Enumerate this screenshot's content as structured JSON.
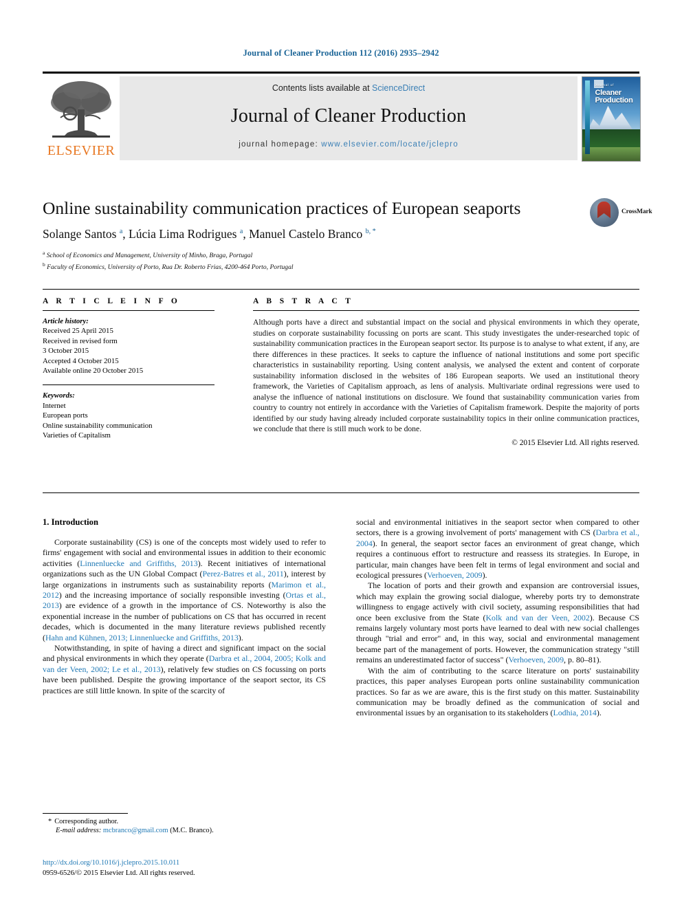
{
  "running_head": "Journal of Cleaner Production 112 (2016) 2935–2942",
  "banner": {
    "contents_prefix": "Contents lists available at ",
    "sciencedirect": "ScienceDirect",
    "journal_name": "Journal of Cleaner Production",
    "homepage_label": "journal homepage: ",
    "homepage_url": "www.elsevier.com/locate/jclepro",
    "publisher_wordmark": "ELSEVIER",
    "cover_kicker": "Journal of",
    "cover_title_line1": "Cleaner",
    "cover_title_line2": "Production"
  },
  "article": {
    "title": "Online sustainability communication practices of European seaports",
    "authors_html": "Solange Santos <sup class=\"aff\">a</sup>, Lúcia Lima Rodrigues <sup class=\"aff\">a</sup>, Manuel Castelo Branco <sup class=\"aff\">b, *</sup>",
    "affiliation_a": "School of Economics and Management, University of Minho, Braga, Portugal",
    "affiliation_b": "Faculty of Economics, University of Porto, Rua Dr. Roberto Frias, 4200-464 Porto, Portugal",
    "crossmark_label": "CrossMark"
  },
  "info": {
    "heading": "A R T I C L E  I N F O",
    "history_label": "Article history:",
    "history": [
      "Received 25 April 2015",
      "Received in revised form",
      "3 October 2015",
      "Accepted 4 October 2015",
      "Available online 20 October 2015"
    ],
    "keywords_label": "Keywords:",
    "keywords": [
      "Internet",
      "European ports",
      "Online sustainability communication",
      "Varieties of Capitalism"
    ]
  },
  "abstract": {
    "heading": "A B S T R A C T",
    "text": "Although ports have a direct and substantial impact on the social and physical environments in which they operate, studies on corporate sustainability focussing on ports are scant. This study investigates the under-researched topic of sustainability communication practices in the European seaport sector. Its purpose is to analyse to what extent, if any, are there differences in these practices. It seeks to capture the influence of national institutions and some port specific characteristics in sustainability reporting. Using content analysis, we analysed the extent and content of corporate sustainability information disclosed in the websites of 186 European seaports. We used an institutional theory framework, the Varieties of Capitalism approach, as lens of analysis. Multivariate ordinal regressions were used to analyse the influence of national institutions on disclosure. We found that sustainability communication varies from country to country not entirely in accordance with the Varieties of Capitalism framework. Despite the majority of ports identified by our study having already included corporate sustainability topics in their online communication practices, we conclude that there is still much work to be done.",
    "copyright": "© 2015 Elsevier Ltd. All rights reserved."
  },
  "body": {
    "section_heading": "1. Introduction",
    "left_paragraphs_html": [
      "Corporate sustainability (CS) is one of the concepts most widely used to refer to firms' engagement with social and environmental issues in addition to their economic activities (<span class=\"cite\">Linnenluecke and Griffiths, 2013</span>). Recent initiatives of international organizations such as the UN Global Compact (<span class=\"cite\">Perez-Batres et al., 2011</span>), interest by large organizations in instruments such as sustainability reports (<span class=\"cite\">Marimon et al., 2012</span>) and the increasing importance of socially responsible investing (<span class=\"cite\">Ortas et al., 2013</span>) are evidence of a growth in the importance of CS. Noteworthy is also the exponential increase in the number of publications on CS that has occurred in recent decades, which is documented in the many literature reviews published recently (<span class=\"cite\">Hahn and Kühnen, 2013; Linnenluecke and Griffiths, 2013</span>).",
      "Notwithstanding, in spite of having a direct and significant impact on the social and physical environments in which they operate (<span class=\"cite\">Darbra et al., 2004, 2005; Kolk and van der Veen, 2002; Le et al., 2013</span>), relatively few studies on CS focussing on ports have been published. Despite the growing importance of the seaport sector, its CS practices are still little known. In spite of the scarcity of"
    ],
    "right_paragraphs_html": [
      "social and environmental initiatives in the seaport sector when compared to other sectors, there is a growing involvement of ports' management with CS (<span class=\"cite\">Darbra et al., 2004</span>). In general, the seaport sector faces an environment of great change, which requires a continuous effort to restructure and reassess its strategies. In Europe, in particular, main changes have been felt in terms of legal environment and social and ecological pressures (<span class=\"cite\">Verhoeven, 2009</span>).",
      "The location of ports and their growth and expansion are controversial issues, which may explain the growing social dialogue, whereby ports try to demonstrate willingness to engage actively with civil society, assuming responsibilities that had once been exclusive from the State (<span class=\"cite\">Kolk and van der Veen, 2002</span>). Because CS remains largely voluntary most ports have learned to deal with new social challenges through \"trial and error\" and, in this way, social and environmental management became part of the management of ports. However, the communication strategy \"still remains an underestimated factor of success\" (<span class=\"cite\">Verhoeven, 2009</span>, p. 80–81).",
      "With the aim of contributing to the scarce literature on ports' sustainability practices, this paper analyses European ports online sustainability communication practices. So far as we are aware, this is the first study on this matter. Sustainability communication may be broadly defined as the communication of social and environmental issues by an organisation to its stakeholders (<span class=\"cite\">Lodhia, 2014</span>)."
    ]
  },
  "footnote": {
    "corresponding": "Corresponding author.",
    "email_label": "E-mail address:",
    "email": "mcbranco@gmail.com",
    "email_owner": "(M.C. Branco).",
    "doi": "http://dx.doi.org/10.1016/j.jclepro.2015.10.011",
    "issn_line": "0959-6526/© 2015 Elsevier Ltd. All rights reserved."
  },
  "colors": {
    "link": "#2079b5",
    "running_head": "#1a6496",
    "elsevier_orange": "#E87722"
  }
}
